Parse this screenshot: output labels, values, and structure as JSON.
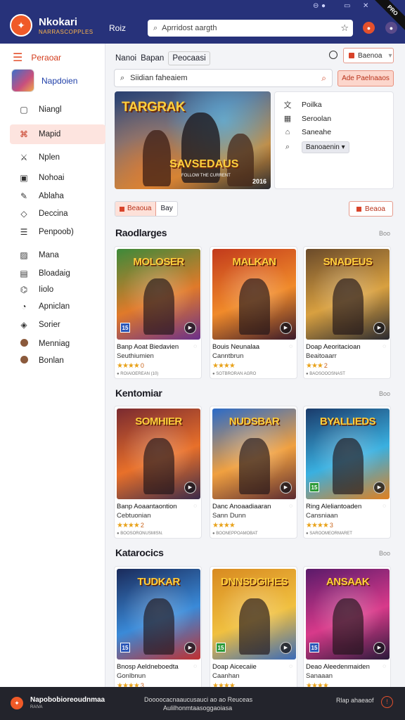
{
  "window": {
    "ribbon": "PRO"
  },
  "header": {
    "brand": "Nkokari",
    "brand_sub": "NARRASCOPPLES",
    "nav_link": "Roiz",
    "search_placeholder": "Aprridost aargth"
  },
  "sidebar": {
    "top_label": "Peraoar",
    "user_name": "Napdoien",
    "items": [
      {
        "icon": "monitor-icon",
        "glyph": "▢",
        "label": "Niangl"
      },
      {
        "icon": "controller-icon",
        "glyph": "⌘",
        "label": "Mapid",
        "active": true
      },
      {
        "icon": "sword-icon",
        "glyph": "⚔",
        "label": "Nplen"
      },
      {
        "icon": "box-icon",
        "glyph": "▣",
        "label": "Nohoai"
      },
      {
        "icon": "pencil-icon",
        "glyph": "✎",
        "label": "Ablaha"
      },
      {
        "icon": "ticket-icon",
        "glyph": "◇",
        "label": "Deccina"
      },
      {
        "icon": "list-icon",
        "glyph": "☰",
        "label": "Penpoob)"
      },
      {
        "icon": "image-icon",
        "glyph": "▨",
        "label": "Mana"
      },
      {
        "icon": "folder-icon",
        "glyph": "▤",
        "label": "Bloadaig"
      },
      {
        "icon": "link-icon",
        "glyph": "⌬",
        "label": "Iiolo"
      },
      {
        "icon": "globe-icon",
        "glyph": "◔",
        "label": "Apniclan"
      },
      {
        "icon": "shield-icon",
        "glyph": "◈",
        "label": "Sorier"
      },
      {
        "icon": "dot-icon",
        "glyph": "",
        "label": "Menniag"
      },
      {
        "icon": "dot-icon",
        "glyph": "",
        "label": "Bonlan"
      }
    ]
  },
  "main": {
    "crumbs": [
      "Nanoi",
      "Bapan",
      "Peocaasi"
    ],
    "sort_label": "Baenoa",
    "search_placeholder": "Siidian faheaiem",
    "filter_label": "Ade Paelnaaos",
    "hero": {
      "title": "TARGRAK",
      "subtitle": "SAVSEDAUS",
      "tagline": "FOLLOW THE CURRENT",
      "corner": "2016"
    },
    "panel": {
      "items": [
        {
          "icon": "translate-icon",
          "glyph": "文",
          "label": "Poilka"
        },
        {
          "icon": "calendar-icon",
          "glyph": "▦",
          "label": "Seroolan"
        },
        {
          "icon": "tag-icon",
          "glyph": "⌂",
          "label": "Saneahe"
        },
        {
          "icon": "search-icon",
          "glyph": "⌕",
          "label": "Banoaenin"
        }
      ],
      "select_value": "Banoaenin"
    },
    "toggle": {
      "on_label": "Beaoua",
      "off_label": "Bay"
    },
    "action_label": "Beaoa",
    "sections": [
      {
        "title": "Raodlarges",
        "more": "Boo",
        "cards": [
          {
            "art": "MOLOSER",
            "title": "Banp Aoat Biedavien",
            "sub": "Seuthiumien",
            "stars": "★★★★",
            "rating": "0",
            "meta": "● ROIAIOEREAN (10)",
            "badge": "15",
            "badge_color": "blue"
          },
          {
            "art": "MALKAN",
            "title": "Bouis Neunalaa",
            "sub": "Canntbrun",
            "stars": "★★★★",
            "rating": "",
            "meta": "● SOTBRORAN AGRO",
            "badge": "",
            "badge_color": ""
          },
          {
            "art": "SNADEUS",
            "title": "Doap Aeoritacioan",
            "sub": "Beaitoaarr",
            "stars": "★★★",
            "rating": "2",
            "meta": "● BAOSOOOSNAST",
            "badge": "",
            "badge_color": ""
          }
        ]
      },
      {
        "title": "Kentomiar",
        "more": "Boo",
        "cards": [
          {
            "art": "SOMHIER",
            "title": "Banp Aoaantaontion",
            "sub": "Cebtuonian",
            "stars": "★★★★",
            "rating": "2",
            "meta": "● BOOSORONUSMISN.",
            "badge": "",
            "badge_color": ""
          },
          {
            "art": "NUDSBAR",
            "title": "Danc Anoaadiaaran",
            "sub": "Sann Dunn",
            "stars": "★★★★",
            "rating": "",
            "meta": "● BOONEPPOAMOBAT",
            "badge": "",
            "badge_color": ""
          },
          {
            "art": "BYALLIEDS",
            "title": "Ring Aleliantoaden",
            "sub": "Cansniaan",
            "stars": "★★★★",
            "rating": "3",
            "meta": "● SAROOMEORMARET",
            "badge": "15",
            "badge_color": "green"
          }
        ]
      },
      {
        "title": "Katarocics",
        "more": "Boo",
        "cards": [
          {
            "art": "TUDKAR",
            "title": "Bnosp Aeldneboedta",
            "sub": "Gonlbnun",
            "stars": "★★★★",
            "rating": "3",
            "meta": "",
            "badge": "15",
            "badge_color": "blue"
          },
          {
            "art": "DNNSDGIHES",
            "title": "Doap Aicecaiie",
            "sub": "Caanhan",
            "stars": "★★★★",
            "rating": "",
            "meta": "",
            "badge": "15",
            "badge_color": "green"
          },
          {
            "art": "ANSAAK",
            "title": "Deao Aleedenmaiden",
            "sub": "Sanaaan",
            "stars": "★★★★",
            "rating": "",
            "meta": "",
            "badge": "15",
            "badge_color": "blue"
          }
        ]
      }
    ]
  },
  "footer": {
    "brand": "Napobobioreoudnmaa",
    "brand_sub": "RAIVA",
    "center_line1": "Doooocacnaaucusauci ao ao Reuceas",
    "center_line2": "Aulilhonmtaasoggaoiasa",
    "right_text": "Rlap ahaeaof"
  },
  "colors": {
    "header_bg": "#27327a",
    "accent": "#e4502c",
    "sidebar_active_bg": "#fde4df",
    "footer_bg": "#23242c",
    "star": "#e8a21a"
  }
}
